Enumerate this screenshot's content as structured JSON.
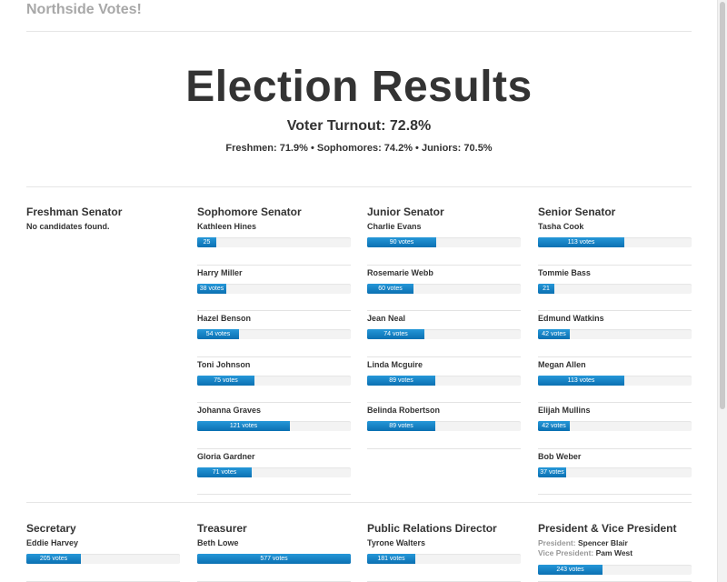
{
  "brand": "Northside Votes!",
  "hero": {
    "title": "Election Results",
    "turnout": "Voter Turnout: 72.8%",
    "class_turnout": "Freshmen: 71.9% • Sophomores: 74.2% • Juniors: 70.5%"
  },
  "colors": {
    "bar_fill": "#1a85c9",
    "bar_track": "#f3f3f3",
    "brand": "#a8a8a8"
  },
  "bar_scale_max_votes": 200,
  "sections": [
    {
      "title": "Freshman Senator",
      "empty_text": "No candidates found.",
      "candidates": []
    },
    {
      "title": "Sophomore Senator",
      "candidates": [
        {
          "name": "Kathleen Hines",
          "votes": 25,
          "label": "25"
        },
        {
          "name": "Harry Miller",
          "votes": 38,
          "label": "38 votes"
        },
        {
          "name": "Hazel Benson",
          "votes": 54,
          "label": "54 votes"
        },
        {
          "name": "Toni Johnson",
          "votes": 75,
          "label": "75 votes"
        },
        {
          "name": "Johanna Graves",
          "votes": 121,
          "label": "121 votes"
        },
        {
          "name": "Gloria Gardner",
          "votes": 71,
          "label": "71 votes"
        }
      ]
    },
    {
      "title": "Junior Senator",
      "candidates": [
        {
          "name": "Charlie Evans",
          "votes": 90,
          "label": "90 votes"
        },
        {
          "name": "Rosemarie Webb",
          "votes": 60,
          "label": "60 votes"
        },
        {
          "name": "Jean Neal",
          "votes": 74,
          "label": "74 votes"
        },
        {
          "name": "Linda Mcguire",
          "votes": 89,
          "label": "89 votes"
        },
        {
          "name": "Belinda Robertson",
          "votes": 89,
          "label": "89 votes"
        }
      ]
    },
    {
      "title": "Senior Senator",
      "candidates": [
        {
          "name": "Tasha Cook",
          "votes": 113,
          "label": "113 votes"
        },
        {
          "name": "Tommie Bass",
          "votes": 21,
          "label": "21"
        },
        {
          "name": "Edmund Watkins",
          "votes": 42,
          "label": "42 votes"
        },
        {
          "name": "Megan Allen",
          "votes": 113,
          "label": "113 votes"
        },
        {
          "name": "Elijah Mullins",
          "votes": 42,
          "label": "42 votes"
        },
        {
          "name": "Bob Weber",
          "votes": 37,
          "label": "37 votes"
        }
      ]
    },
    {
      "title": "Secretary",
      "candidates": [
        {
          "name": "Eddie Harvey",
          "votes": 205,
          "label": "205 votes",
          "scale": 577
        }
      ]
    },
    {
      "title": "Treasurer",
      "candidates": [
        {
          "name": "Beth Lowe",
          "votes": 577,
          "label": "577 votes",
          "scale": 577
        }
      ]
    },
    {
      "title": "Public Relations Director",
      "candidates": [
        {
          "name": "Tyrone Walters",
          "votes": 181,
          "label": "181 votes",
          "scale": 577
        }
      ]
    },
    {
      "title": "President & Vice President",
      "candidates": [
        {
          "president_label": "President:",
          "president": "Spencer Blair",
          "vp_label": "Vice President:",
          "vp": "Pam West",
          "votes": 243,
          "label": "243 votes",
          "scale": 577
        }
      ]
    }
  ]
}
